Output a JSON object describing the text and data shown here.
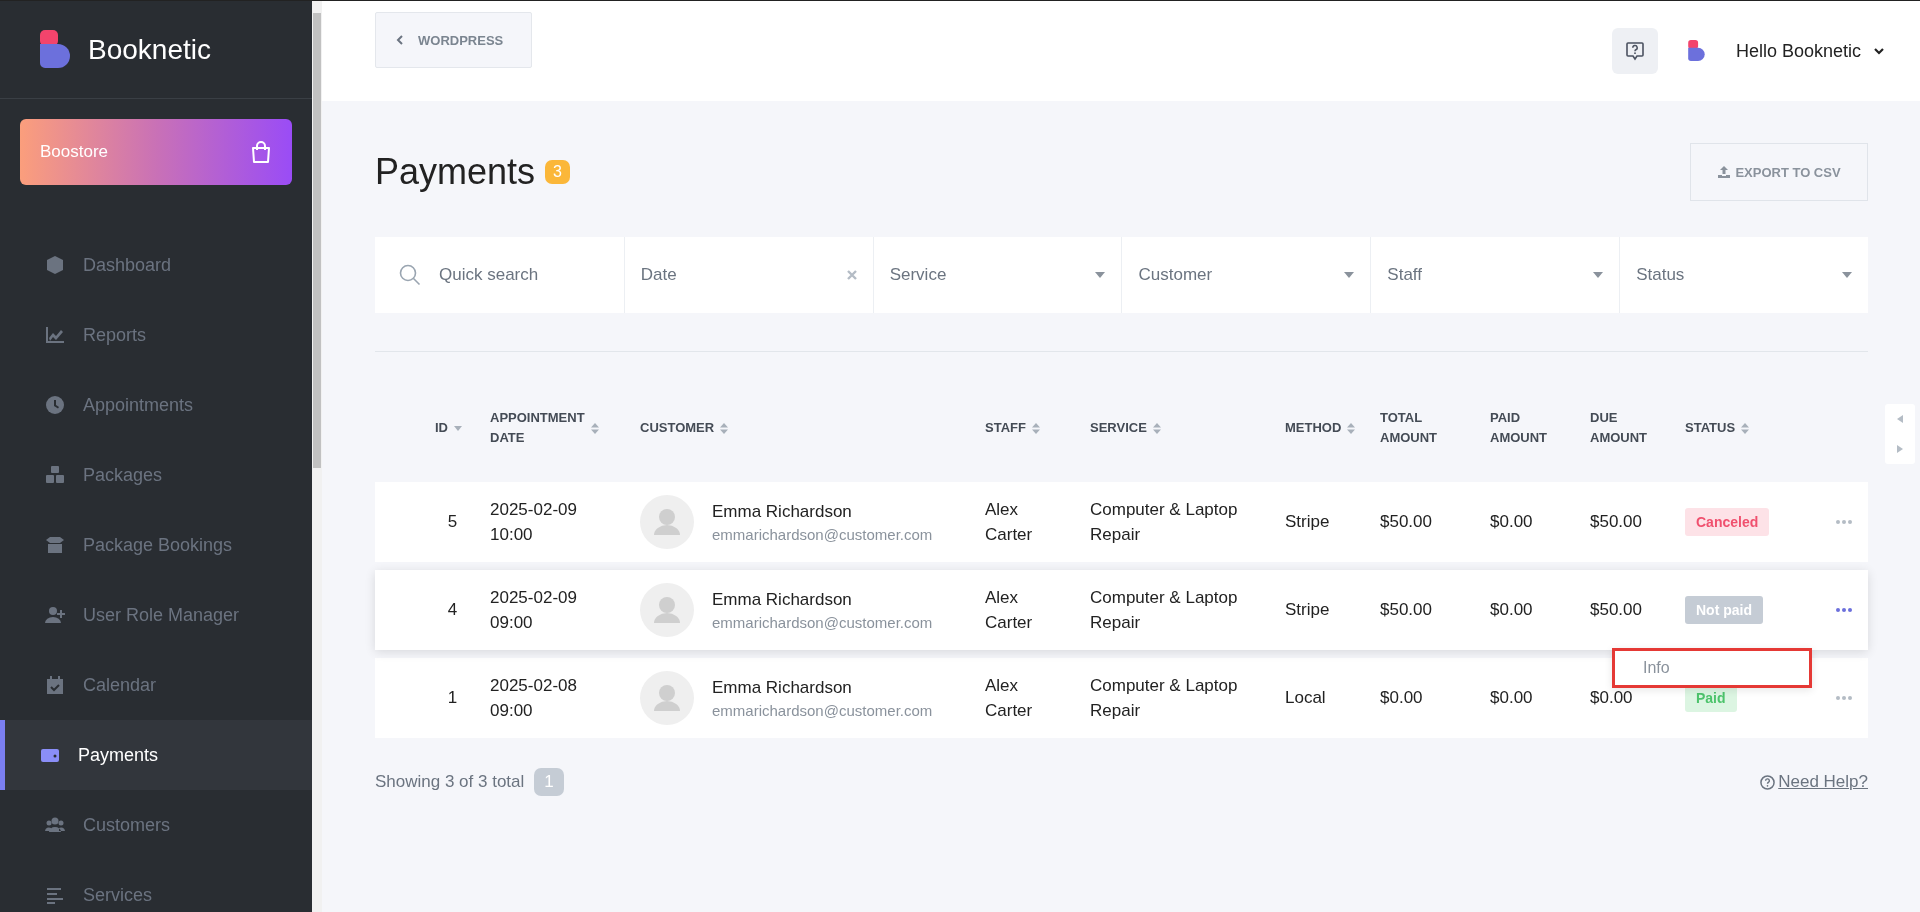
{
  "sidebar": {
    "brand": "Booknetic",
    "store_button": "Boostore",
    "items": [
      {
        "label": "Dashboard",
        "selected": false
      },
      {
        "label": "Reports",
        "selected": false
      },
      {
        "label": "Appointments",
        "selected": false
      },
      {
        "label": "Packages",
        "selected": false
      },
      {
        "label": "Package Bookings",
        "selected": false
      },
      {
        "label": "User Role Manager",
        "selected": false
      },
      {
        "label": "Calendar",
        "selected": false
      },
      {
        "label": "Payments",
        "selected": true
      },
      {
        "label": "Customers",
        "selected": false
      },
      {
        "label": "Services",
        "selected": false
      }
    ]
  },
  "header": {
    "back_button": "WORDPRESS",
    "user_menu": "Hello Booknetic"
  },
  "page": {
    "title": "Payments",
    "count": "3",
    "export_button": "EXPORT TO CSV"
  },
  "filters": [
    {
      "kind": "search",
      "placeholder": "Quick search"
    },
    {
      "kind": "date",
      "placeholder": "Date"
    },
    {
      "kind": "select",
      "placeholder": "Service"
    },
    {
      "kind": "select",
      "placeholder": "Customer"
    },
    {
      "kind": "select",
      "placeholder": "Staff"
    },
    {
      "kind": "select",
      "placeholder": "Status"
    }
  ],
  "table": {
    "columns": [
      {
        "label": "ID",
        "sortable": true,
        "sorted": true
      },
      {
        "label": "APPOINTMENT DATE",
        "sortable": true,
        "sorted": false
      },
      {
        "label": "CUSTOMER",
        "sortable": true,
        "sorted": false
      },
      {
        "label": "STAFF",
        "sortable": true,
        "sorted": false
      },
      {
        "label": "SERVICE",
        "sortable": true,
        "sorted": false
      },
      {
        "label": "METHOD",
        "sortable": true,
        "sorted": false
      },
      {
        "label": "TOTAL AMOUNT",
        "sortable": false,
        "sorted": false
      },
      {
        "label": "PAID AMOUNT",
        "sortable": false,
        "sorted": false
      },
      {
        "label": "DUE AMOUNT",
        "sortable": false,
        "sorted": false
      },
      {
        "label": "STATUS",
        "sortable": true,
        "sorted": false
      }
    ],
    "rows": [
      {
        "id": "5",
        "date": "2025-02-09",
        "time": "10:00",
        "name": "Emma Richardson",
        "email": "emmarichardson@customer.com",
        "staff": "Alex Carter",
        "service": "Computer & Laptop Repair",
        "method": "Stripe",
        "total": "$50.00",
        "paid": "$0.00",
        "due": "$50.00",
        "status": "Canceled",
        "color": "#fde2e7",
        "menu_open": false
      },
      {
        "id": "4",
        "date": "2025-02-09",
        "time": "09:00",
        "name": "Emma Richardson",
        "email": "emmarichardson@customer.com",
        "staff": "Alex Carter",
        "service": "Computer & Laptop Repair",
        "method": "Stripe",
        "total": "$50.00",
        "paid": "$0.00",
        "due": "$50.00",
        "status": "Not paid",
        "color": "#c5ccd5",
        "menu_open": true,
        "menu": [
          {
            "label": "Info",
            "highlighted": true
          }
        ]
      },
      {
        "id": "1",
        "date": "2025-02-08",
        "time": "09:00",
        "name": "Emma Richardson",
        "email": "emmarichardson@customer.com",
        "staff": "Alex Carter",
        "service": "Computer & Laptop Repair",
        "method": "Local",
        "total": "$0.00",
        "paid": "$0.00",
        "due": "$0.00",
        "status": "Paid",
        "color": "#dcf5e2",
        "menu_open": false
      }
    ]
  },
  "footer": {
    "summary": "Showing 3 of 3 total",
    "page": "1",
    "help_link": "Need Help?"
  }
}
